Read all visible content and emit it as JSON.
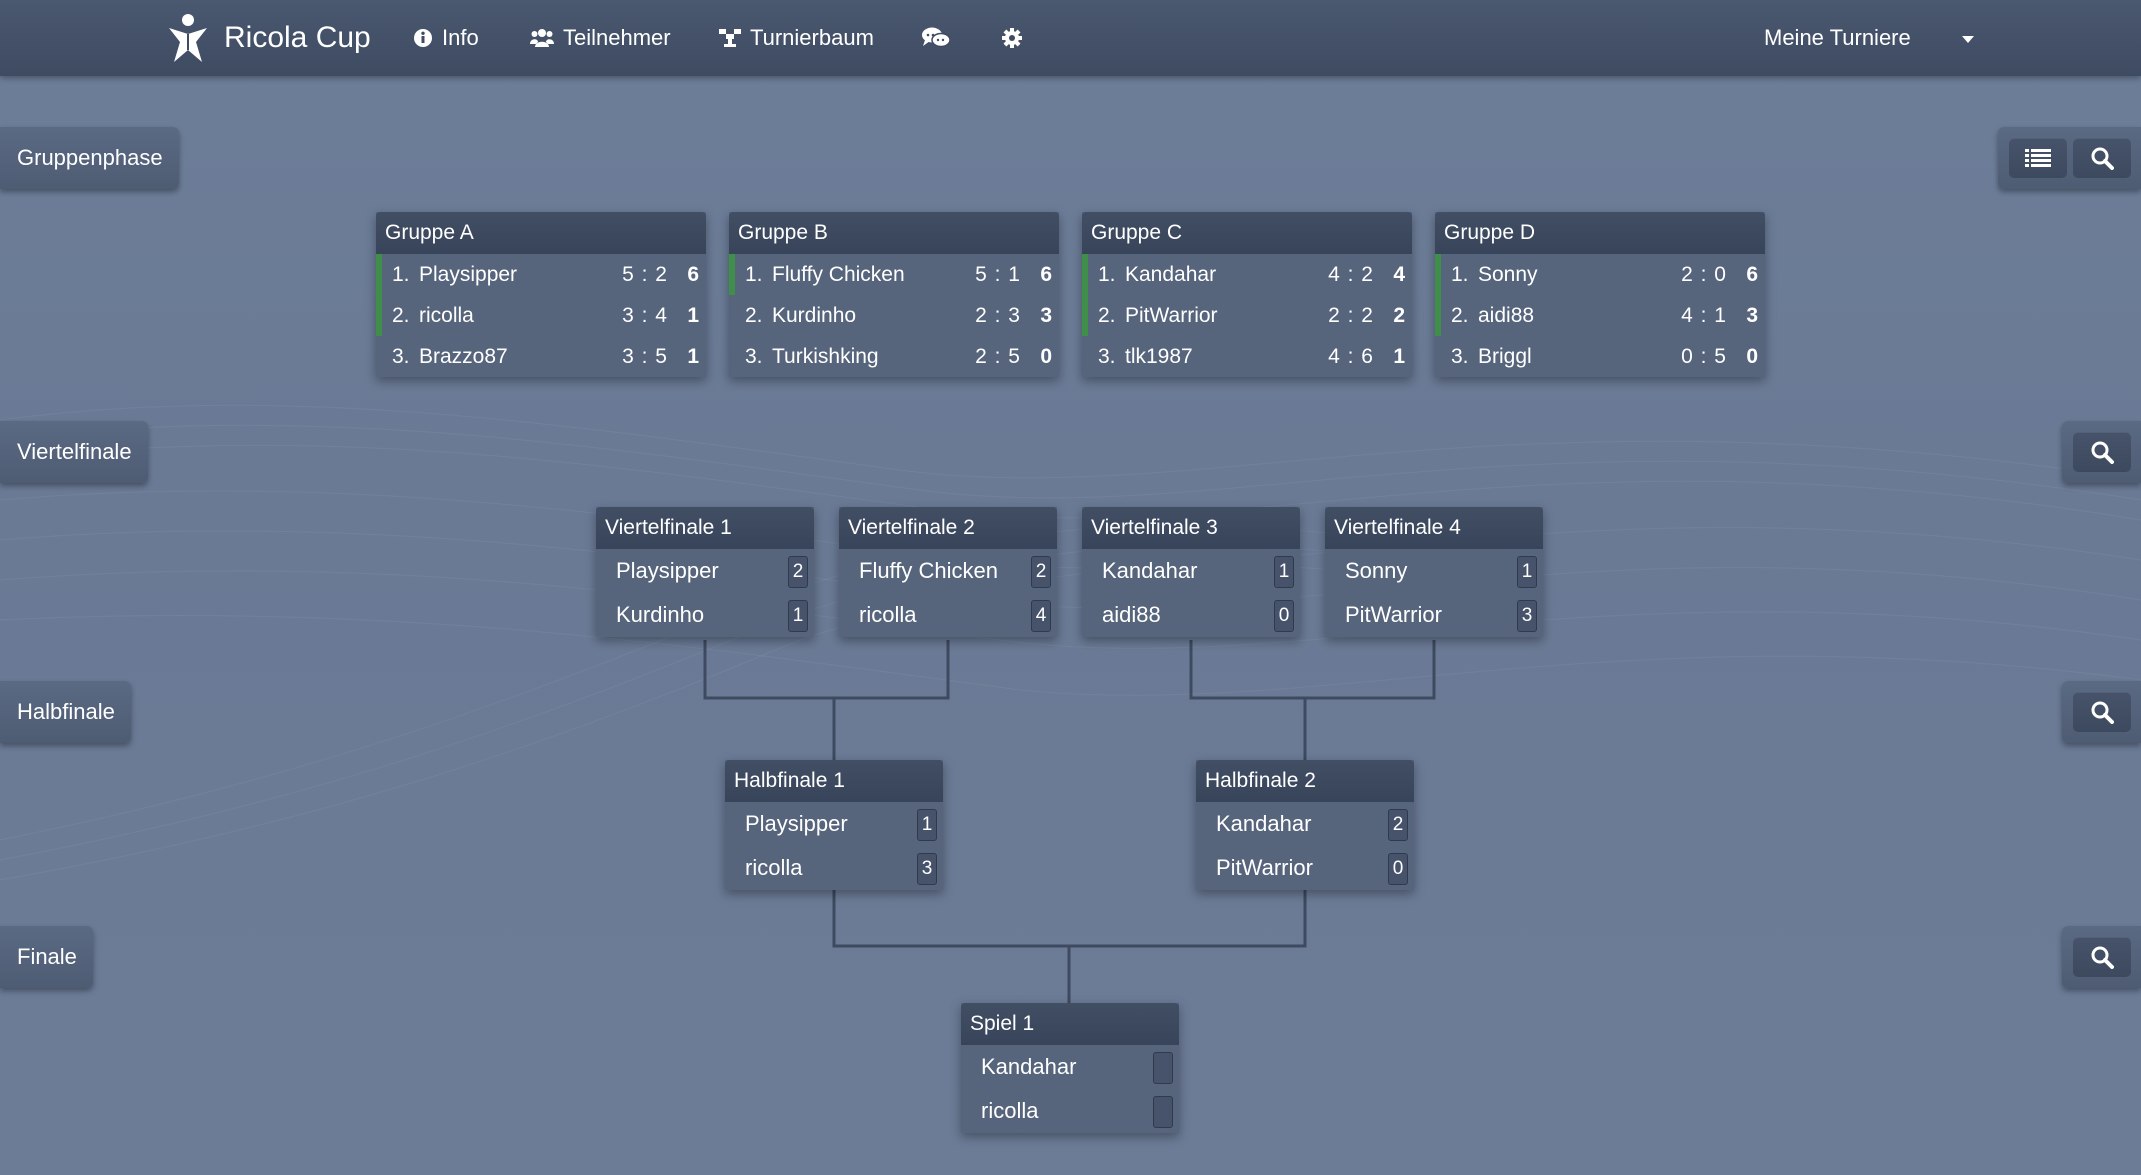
{
  "navbar": {
    "brand": "Ricola Cup",
    "items": [
      "Info",
      "Teilnehmer",
      "Turnierbaum"
    ],
    "dropdown": "Meine Turniere"
  },
  "rounds": {
    "group": "Gruppenphase",
    "quarter": "Viertelfinale",
    "semi": "Halbfinale",
    "final": "Finale"
  },
  "groups": [
    {
      "title": "Gruppe A",
      "rows": [
        {
          "rank": "1.",
          "name": "Playsipper",
          "score": "5 : 2",
          "points": "6"
        },
        {
          "rank": "2.",
          "name": "ricolla",
          "score": "3 : 4",
          "points": "1"
        },
        {
          "rank": "3.",
          "name": "Brazzo87",
          "score": "3 : 5",
          "points": "1"
        }
      ]
    },
    {
      "title": "Gruppe B",
      "rows": [
        {
          "rank": "1.",
          "name": "Fluffy Chicken",
          "score": "5 : 1",
          "points": "6"
        },
        {
          "rank": "2.",
          "name": "Kurdinho",
          "score": "2 : 3",
          "points": "3"
        },
        {
          "rank": "3.",
          "name": "Turkishking",
          "score": "2 : 5",
          "points": "0"
        }
      ]
    },
    {
      "title": "Gruppe C",
      "rows": [
        {
          "rank": "1.",
          "name": "Kandahar",
          "score": "4 : 2",
          "points": "4"
        },
        {
          "rank": "2.",
          "name": "PitWarrior",
          "score": "2 : 2",
          "points": "2"
        },
        {
          "rank": "3.",
          "name": "tlk1987",
          "score": "4 : 6",
          "points": "1"
        }
      ]
    },
    {
      "title": "Gruppe D",
      "rows": [
        {
          "rank": "1.",
          "name": "Sonny",
          "score": "2 : 0",
          "points": "6"
        },
        {
          "rank": "2.",
          "name": "aidi88",
          "score": "4 : 1",
          "points": "3"
        },
        {
          "rank": "3.",
          "name": "Briggl",
          "score": "0 : 5",
          "points": "0"
        }
      ]
    }
  ],
  "quarterfinals": [
    {
      "title": "Viertelfinale 1",
      "p1": "Playsipper",
      "s1": "2",
      "p2": "Kurdinho",
      "s2": "1"
    },
    {
      "title": "Viertelfinale 2",
      "p1": "Fluffy Chicken",
      "s1": "2",
      "p2": "ricolla",
      "s2": "4"
    },
    {
      "title": "Viertelfinale 3",
      "p1": "Kandahar",
      "s1": "1",
      "p2": "aidi88",
      "s2": "0"
    },
    {
      "title": "Viertelfinale 4",
      "p1": "Sonny",
      "s1": "1",
      "p2": "PitWarrior",
      "s2": "3"
    }
  ],
  "semifinals": [
    {
      "title": "Halbfinale 1",
      "p1": "Playsipper",
      "s1": "1",
      "p2": "ricolla",
      "s2": "3"
    },
    {
      "title": "Halbfinale 2",
      "p1": "Kandahar",
      "s1": "2",
      "p2": "PitWarrior",
      "s2": "0"
    }
  ],
  "final": {
    "title": "Spiel 1",
    "p1": "Kandahar",
    "s1": "",
    "p2": "ricolla",
    "s2": ""
  },
  "colors": {
    "advance": "#3f8f4a",
    "navbar": "#3e4b61",
    "background": "#6b7b96"
  }
}
